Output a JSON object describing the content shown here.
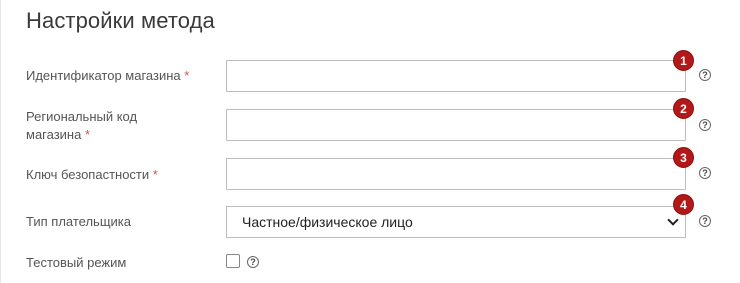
{
  "section_title": "Настройки метода",
  "required_mark": "*",
  "help_glyph": "?",
  "fields": [
    {
      "label": "Идентификатор магазина",
      "value": "",
      "badge": "1"
    },
    {
      "label_line1": "Региональный код",
      "label_line2": "магазина",
      "value": "",
      "badge": "2"
    },
    {
      "label": "Ключ безопастности",
      "value": "",
      "badge": "3"
    },
    {
      "label": "Тип плательщика",
      "selected": "Частное/физическое лицо",
      "badge": "4"
    }
  ],
  "test_mode": {
    "label": "Тестовый режим",
    "checked": false
  }
}
